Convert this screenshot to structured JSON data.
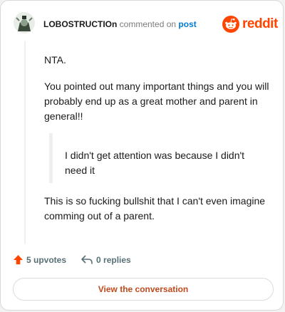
{
  "header": {
    "username": "LOBOSTRUCTIOn",
    "commented_text": "commented on",
    "post_link": "post",
    "brand": "reddit"
  },
  "comment": {
    "paragraph1": "NTA.",
    "paragraph2": "You pointed out many important things and you will probably end up as a great mother and parent in general!!",
    "quote": "I didn't get attention was because I didn't need it",
    "paragraph3": "This is so fucking bullshit that I can't even imagine comming out of a parent."
  },
  "footer": {
    "upvotes": "5 upvotes",
    "replies": "0 replies"
  },
  "cta": {
    "label": "View the conversation"
  },
  "colors": {
    "brand_orange": "#ff4500",
    "link_blue": "#0079d3",
    "cta_text": "#c04a1e",
    "muted": "#576f76"
  },
  "icons": [
    "avatar",
    "reddit-logo-icon",
    "upvote-arrow-icon",
    "reply-icon"
  ]
}
